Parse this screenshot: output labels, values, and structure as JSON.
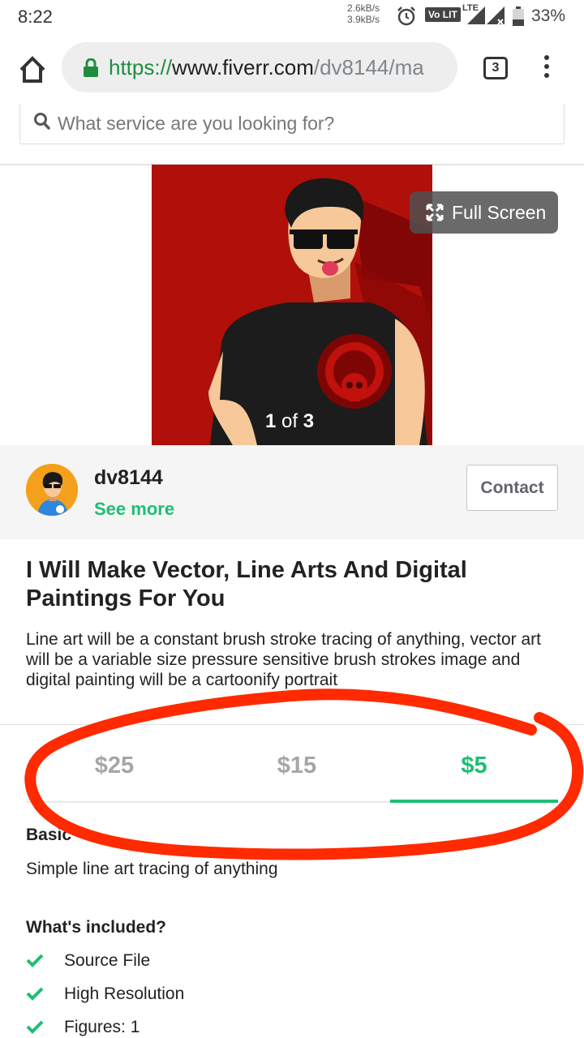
{
  "status_bar": {
    "time": "8:22",
    "net_up": "2.6kB/s",
    "net_down": "3.9kB/s",
    "volte": "Vo LIT",
    "lte": "LTE",
    "battery": "33%",
    "icons": [
      "alarm-icon",
      "signal-icon",
      "battery-icon"
    ]
  },
  "browser": {
    "url_scheme": "https://",
    "url_host": "www.fiverr.com",
    "url_path": "/dv8144/ma",
    "tab_count": "3"
  },
  "search": {
    "placeholder": "What service are you looking for?"
  },
  "gallery": {
    "fullscreen_label": "Full Screen",
    "counter_current": "1",
    "counter_of": "of",
    "counter_total": "3"
  },
  "seller": {
    "name": "dv8144",
    "see_more": "See more",
    "contact_label": "Contact"
  },
  "gig": {
    "title": "I Will Make Vector, Line Arts And Digital Paintings For You",
    "description": "Line art will be a constant brush stroke tracing of anything, vector art will be a variable size pressure sensitive brush strokes image and digital painting will be a cartoonify portrait"
  },
  "packages": {
    "tabs": [
      {
        "price": "$25"
      },
      {
        "price": "$15"
      },
      {
        "price": "$5"
      }
    ],
    "active_index": 2,
    "name": "Basic",
    "description": "Simple line art tracing of anything",
    "included_heading": "What's included?",
    "features": [
      "Source File",
      "High Resolution",
      "Figures: 1"
    ]
  },
  "colors": {
    "accent_green": "#1dbf73",
    "image_bg": "#b00f0a",
    "annotation_red": "#ff2a00"
  }
}
